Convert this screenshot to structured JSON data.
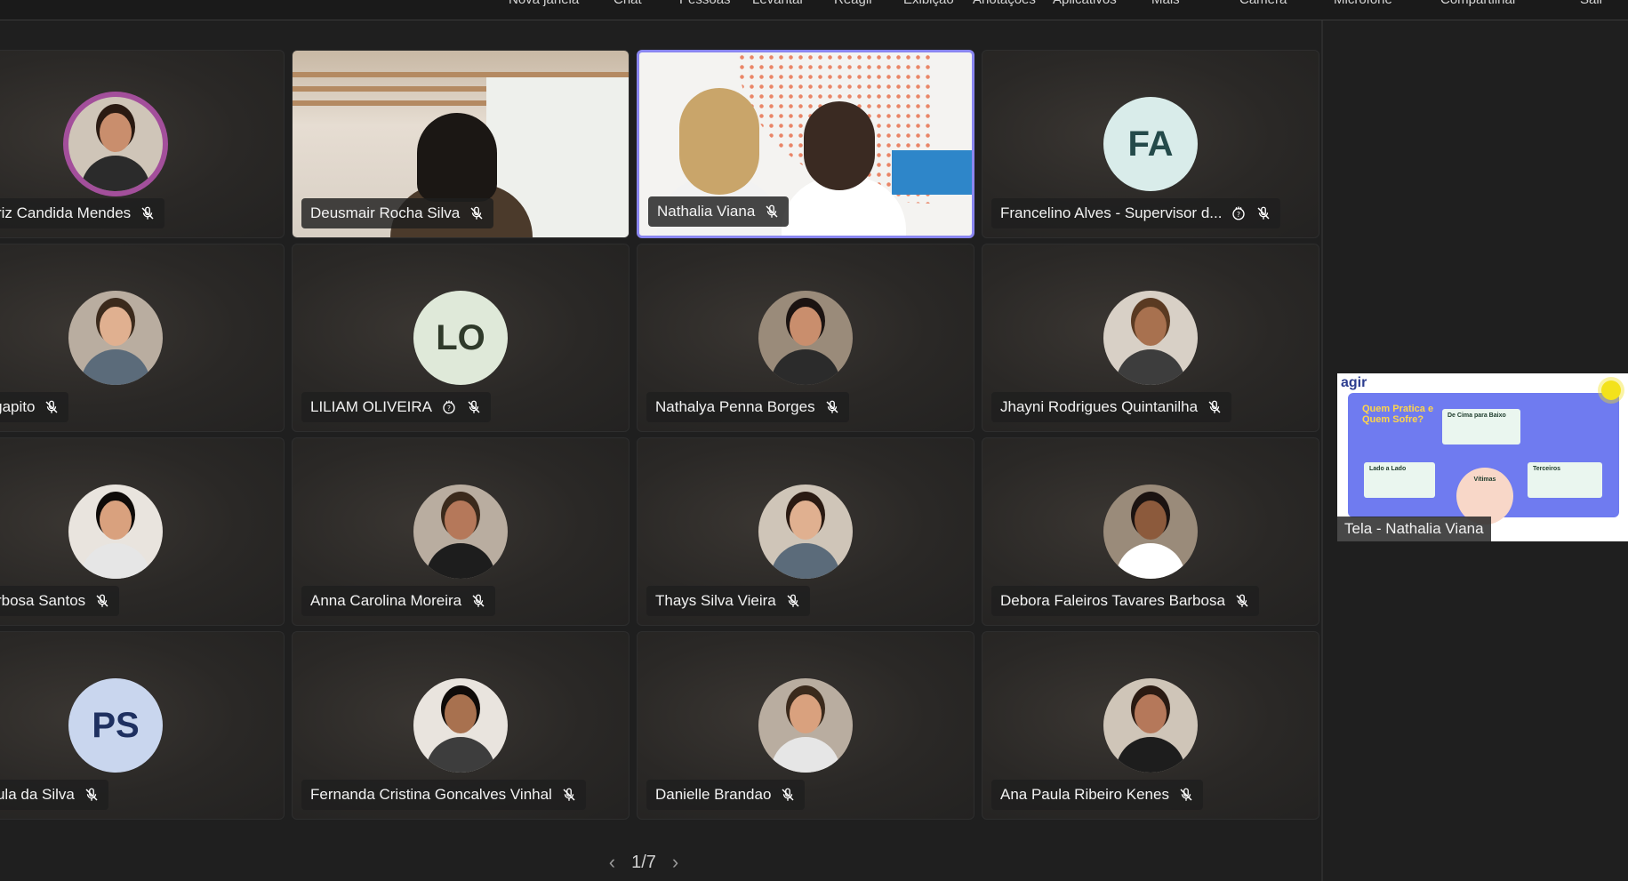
{
  "toolbar": {
    "items": [
      "Nova janela",
      "Chat",
      "Pessoas",
      "Levantar",
      "Reagir",
      "Exibição",
      "Anotações",
      "Aplicativos",
      "Mais",
      "Câmera",
      "Microfone",
      "Compartilhar",
      "Sair"
    ]
  },
  "participants": [
    {
      "name": "Beatriz Candida Mendes",
      "type": "photo",
      "hand": false
    },
    {
      "name": "Deusmair Rocha Silva",
      "type": "video-room",
      "hand": false
    },
    {
      "name": "Nathalia Viana",
      "type": "video-studio",
      "hand": false,
      "active": true
    },
    {
      "name": "Francelino Alves - Supervisor d...",
      "type": "initials",
      "initials": "FA",
      "hand": true
    },
    {
      "name": "llo Agapito",
      "type": "photo",
      "hand": false
    },
    {
      "name": "LILIAM OLIVEIRA",
      "type": "initials",
      "initials": "LO",
      "hand": true
    },
    {
      "name": "Nathalya Penna Borges",
      "type": "photo",
      "hand": false
    },
    {
      "name": "Jhayni Rodrigues Quintanilha",
      "type": "photo",
      "hand": false
    },
    {
      "name": "e Barbosa Santos",
      "type": "photo",
      "hand": false
    },
    {
      "name": "Anna Carolina Moreira",
      "type": "photo",
      "hand": false
    },
    {
      "name": "Thays Silva Vieira",
      "type": "photo",
      "hand": false
    },
    {
      "name": "Debora Faleiros Tavares Barbosa",
      "type": "photo",
      "hand": false
    },
    {
      "name": "a Paula da Silva",
      "type": "initials",
      "initials": "PS",
      "hand": false
    },
    {
      "name": "Fernanda Cristina Goncalves Vinhal",
      "type": "photo",
      "hand": false
    },
    {
      "name": "Danielle Brandao",
      "type": "photo",
      "hand": false
    },
    {
      "name": "Ana Paula Ribeiro Kenes",
      "type": "photo",
      "hand": false
    }
  ],
  "pager": {
    "text": "1/7"
  },
  "screen_share": {
    "label": "Tela - Nathalia Viana",
    "logo": "agir",
    "heading": "Quem Pratica e Quem Sofre?",
    "boxes": [
      "De Cima para Baixo",
      "Lado a Lado",
      "Terceiros",
      "Vítimas"
    ]
  },
  "colors": {
    "active_border": "#8a86f0",
    "initials_FA": "#d9ecea",
    "initials_LO": "#dfe9d9",
    "initials_PS": "#c9d6ee"
  }
}
